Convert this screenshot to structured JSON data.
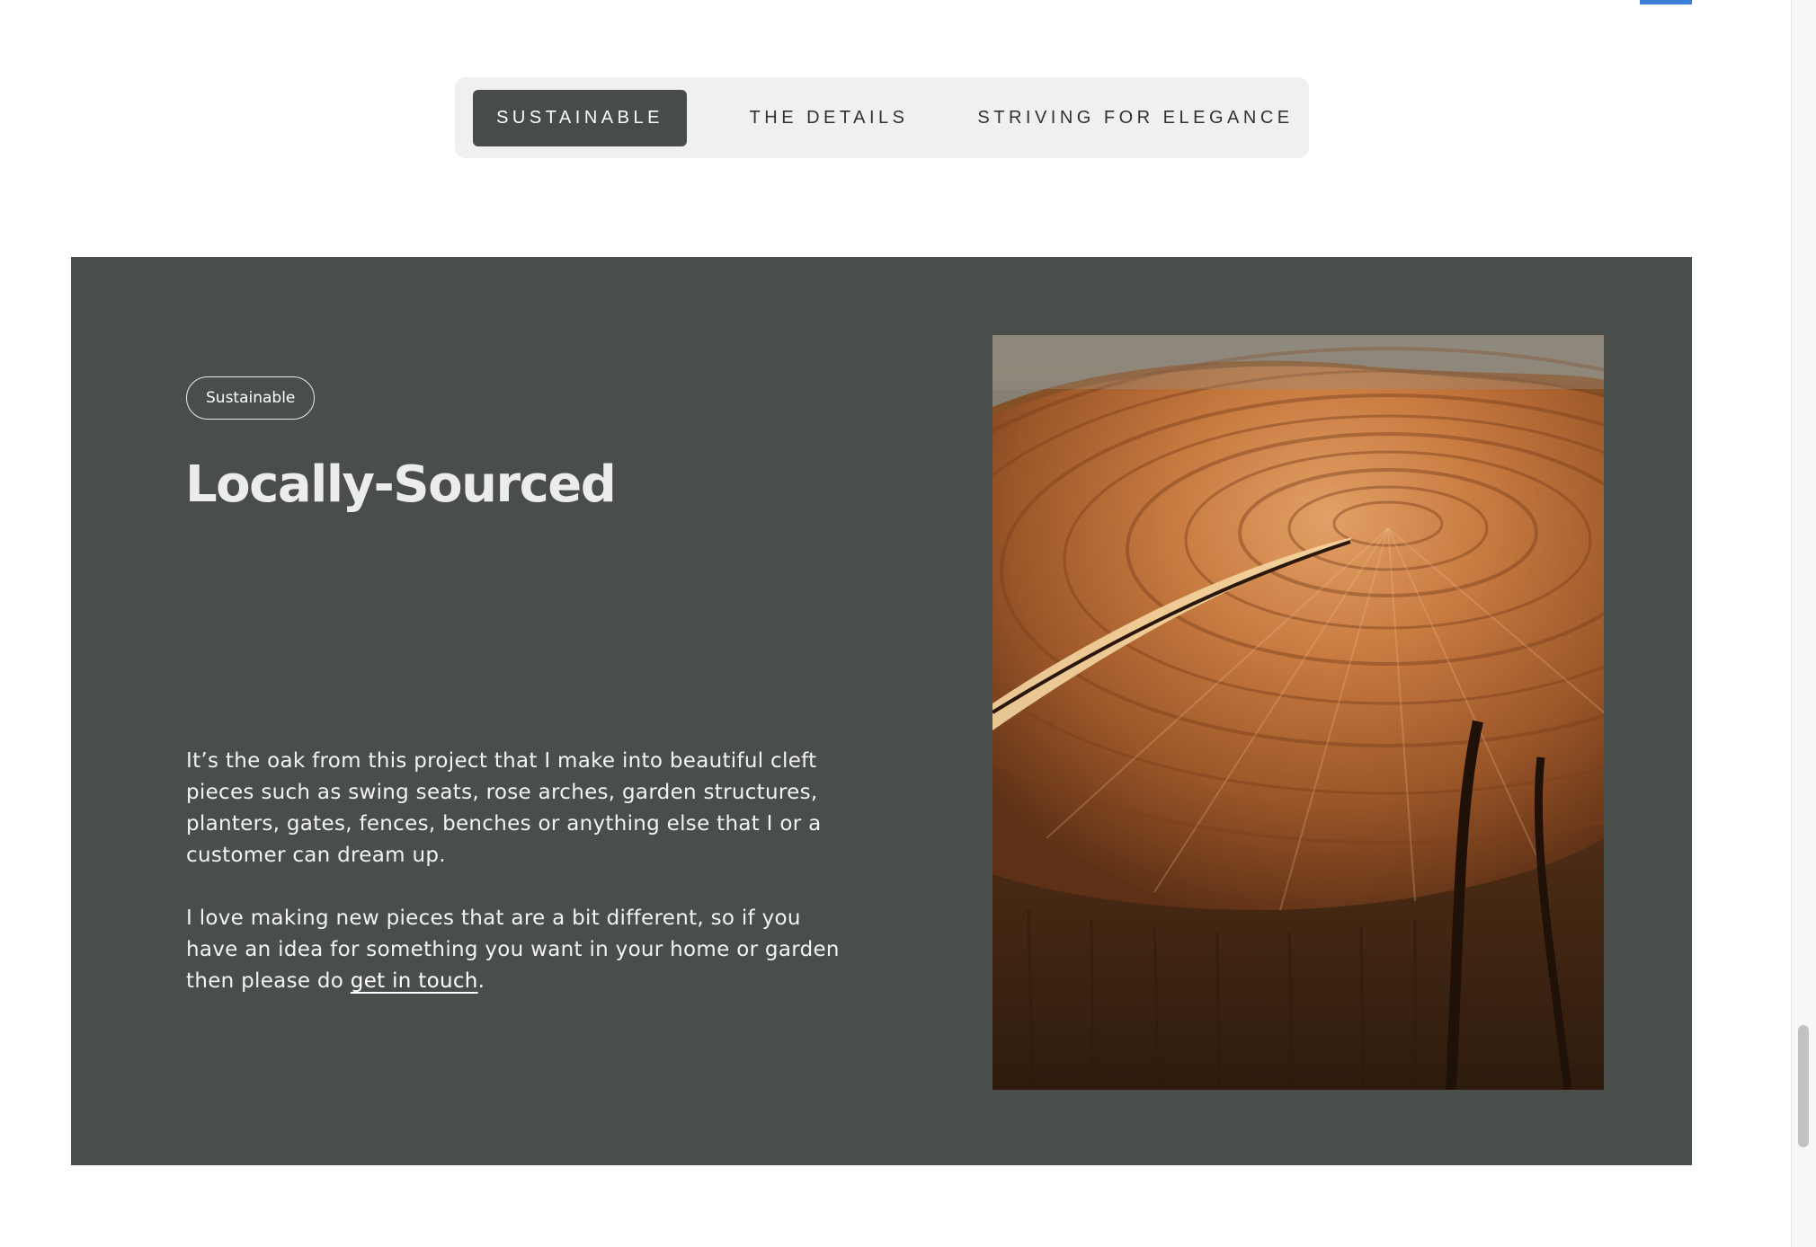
{
  "tabs": [
    {
      "label": "SUSTAINABLE",
      "active": true
    },
    {
      "label": "THE DETAILS",
      "active": false
    },
    {
      "label": "STRIVING FOR ELEGANCE",
      "active": false
    }
  ],
  "section": {
    "tag": "Sustainable",
    "heading": "Locally-Sourced",
    "paragraph1": "It’s the oak from this project that I make into beautiful cleft pieces such as swing seats, rose arches, garden structures, planters, gates, fences, benches or anything else that I or a customer can dream up.",
    "paragraph2_before": "I love making new pieces that are a bit different, so if you have an idea for something you want in your home or garden then please do ",
    "paragraph2_link": "get in touch",
    "paragraph2_after": ".",
    "image_subject": "cleft-oak-log-cross-section"
  },
  "colors": {
    "section_bg": "#4a4e4b",
    "active_tab_bg": "#484c49",
    "tab_bar_bg": "#f0f0f0",
    "accent": "#3b7fd6"
  }
}
